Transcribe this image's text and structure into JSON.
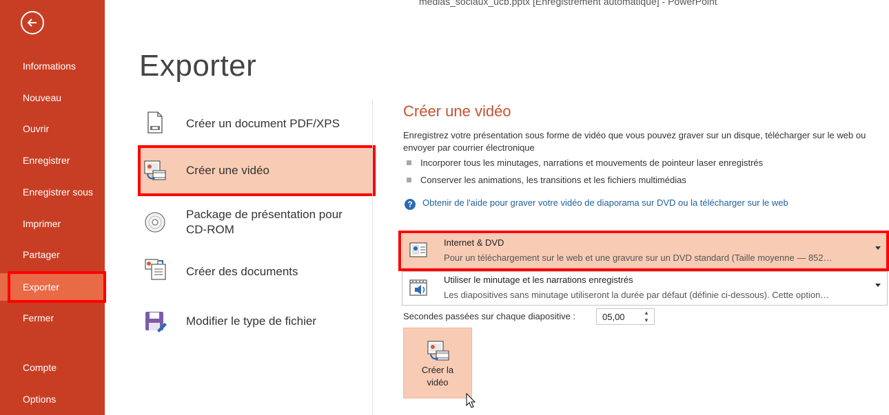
{
  "window": {
    "title": "medias_sociaux_ucb.pptx [Enregistrement automatique] - PowerPoint"
  },
  "sidebar": {
    "back_icon": "back-arrow-icon",
    "items": [
      {
        "label": "Informations"
      },
      {
        "label": "Nouveau"
      },
      {
        "label": "Ouvrir"
      },
      {
        "label": "Enregistrer"
      },
      {
        "label": "Enregistrer sous"
      },
      {
        "label": "Imprimer"
      },
      {
        "label": "Partager"
      },
      {
        "label": "Exporter",
        "active": true
      },
      {
        "label": "Fermer"
      },
      {
        "label": "Compte"
      },
      {
        "label": "Options"
      }
    ],
    "colors": {
      "background": "#c83e24",
      "active": "#e86a47"
    }
  },
  "page": {
    "title": "Exporter"
  },
  "export_options": [
    {
      "label": "Créer un document PDF/XPS",
      "icon": "pdf-document-icon"
    },
    {
      "label": "Créer une vidéo",
      "icon": "video-icon",
      "selected": true
    },
    {
      "label": "Package de présentation pour CD-ROM",
      "icon": "cd-icon"
    },
    {
      "label": "Créer des documents",
      "icon": "handouts-icon"
    },
    {
      "label": "Modifier le type de fichier",
      "icon": "save-as-icon"
    }
  ],
  "video_panel": {
    "title": "Créer une vidéo",
    "description": "Enregistrez votre présentation sous forme de vidéo que vous pouvez graver sur un disque, télécharger sur le web ou envoyer par courrier électronique",
    "bullets": [
      "Incorporer tous les minutages, narrations et mouvements de pointeur laser enregistrés",
      "Conserver les animations, les transitions et les fichiers multimédias"
    ],
    "help_link": "Obtenir de l'aide pour graver votre vidéo de diaporama sur DVD ou la télécharger sur le web",
    "quality_dropdown": {
      "title": "Internet & DVD",
      "subtitle": "Pour un téléchargement sur le web et une gravure sur un DVD standard (Taille moyenne — 852…",
      "icon": "monitor-icon"
    },
    "timing_dropdown": {
      "title": "Utiliser le minutage et les narrations enregistrés",
      "subtitle": "Les diapositives sans minutage utiliseront la durée par défaut (définie ci-dessous). Cette option…",
      "icon": "timing-audio-icon"
    },
    "seconds_label": "Secondes passées sur chaque diapositive :",
    "seconds_value": "05,00",
    "create_button": {
      "line1": "Créer la",
      "line2": "vidéo"
    }
  },
  "colors": {
    "accent": "#c8502f",
    "selection": "#f8cbb4",
    "highlight": "#ff0000",
    "link": "#1f5f9c"
  }
}
